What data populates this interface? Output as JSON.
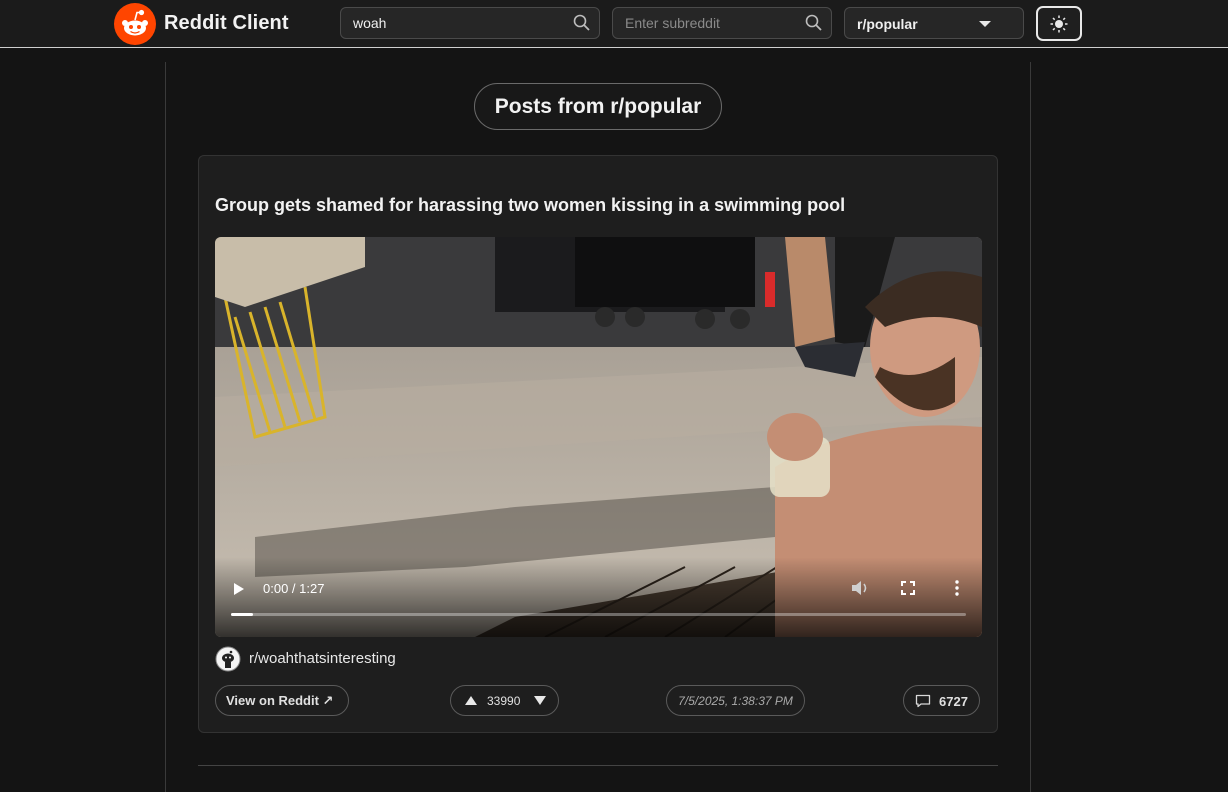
{
  "header": {
    "brand": "Reddit Client",
    "search_value": "woah",
    "subreddit_placeholder": "Enter subreddit",
    "feed_select": "r/popular",
    "theme_icon": "sun-icon"
  },
  "main": {
    "heading": "Posts from r/popular"
  },
  "post": {
    "title": "Group gets shamed for harassing two women kissing in a swimming pool",
    "video": {
      "time": "0:00 / 1:27",
      "progress": 0.03
    },
    "subreddit": "r/woahthatsinteresting",
    "view_label": "View on Reddit ↗",
    "score": "33990",
    "date": "7/5/2025, 1:38:37 PM",
    "comments": "6727"
  },
  "colors": {
    "background": "#141414",
    "card": "#1e1e1e",
    "brand_orange": "#ff4500"
  }
}
